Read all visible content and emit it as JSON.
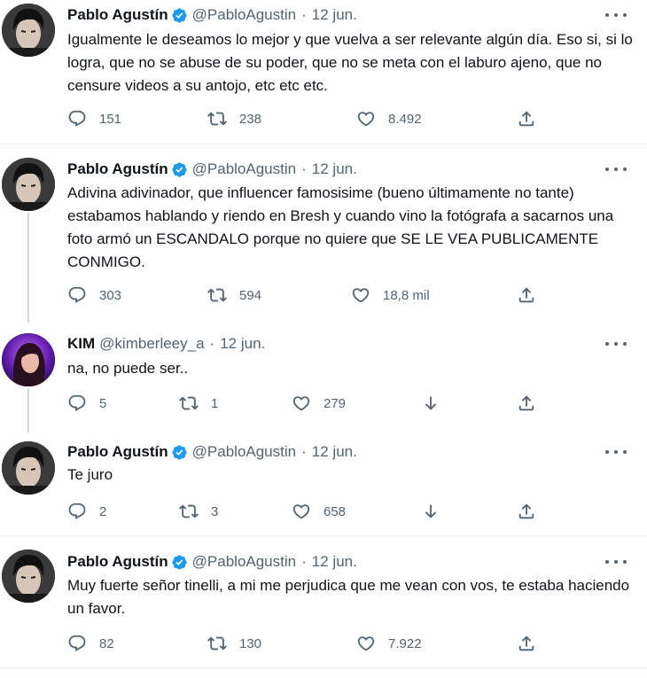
{
  "tweets": [
    {
      "name": "Pablo Agustín",
      "handle": "@PabloAgustin",
      "date": "12 jun.",
      "text": "Igualmente le deseamos lo mejor y que vuelva a ser relevante algún día. Eso si, si lo logra, que no se abuse de su poder, que no se meta con el laburo ajeno, que no censure videos a su antojo, etc etc etc.",
      "replies": "151",
      "retweets": "238",
      "likes": "8.492"
    },
    {
      "name": "Pablo Agustín",
      "handle": "@PabloAgustin",
      "date": "12 jun.",
      "text": "Adivina adivinador, que influencer famosisime (bueno últimamente no tante) estabamos hablando y riendo en Bresh y cuando vino la fotógrafa a sacarnos una foto armó un ESCANDALO porque no quiere que SE LE VEA PUBLICAMENTE CONMIGO.",
      "replies": "303",
      "retweets": "594",
      "likes": "18,8 mil"
    },
    {
      "name": "KIM",
      "handle": "@kimberleey_a",
      "date": "12 jun.",
      "text": "na, no puede ser..",
      "replies": "5",
      "retweets": "1",
      "likes": "279"
    },
    {
      "name": "Pablo Agustín",
      "handle": "@PabloAgustin",
      "date": "12 jun.",
      "text": "Te juro",
      "replies": "2",
      "retweets": "3",
      "likes": "658"
    },
    {
      "name": "Pablo Agustín",
      "handle": "@PabloAgustin",
      "date": "12 jun.",
      "text": "Muy fuerte señor tinelli, a mi me perjudica que me vean con vos, te estaba haciendo un favor.",
      "replies": "82",
      "retweets": "130",
      "likes": "7.922"
    }
  ],
  "dot_separator": "·",
  "icons": {
    "reply": "reply-icon",
    "retweet": "retweet-icon",
    "like": "like-icon",
    "hide": "hide-reply-icon",
    "share": "share-icon",
    "verified": "verified-badge-icon",
    "more": "more-icon"
  },
  "colors": {
    "verified": "#1d9bf0",
    "secondary_text": "#536471",
    "thread_line": "#cfd9de",
    "divider": "#eff3f4"
  }
}
